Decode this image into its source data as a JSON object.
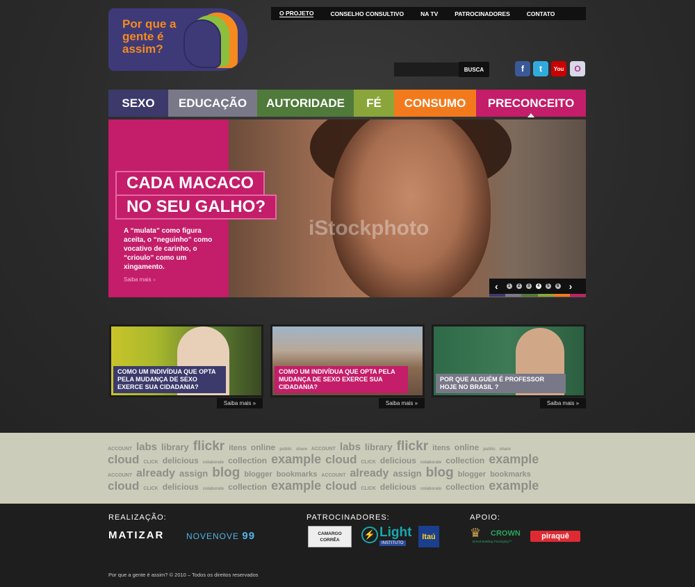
{
  "logo": {
    "text": "Por que a gente é assim?"
  },
  "top_nav": [
    "O PROJETO",
    "CONSELHO CONSULTIVO",
    "NA TV",
    "PATROCINADORES",
    "CONTATO"
  ],
  "search": {
    "button": "BUSCA"
  },
  "social": [
    {
      "icon": "facebook-icon",
      "glyph": "f",
      "color": "#3b5998"
    },
    {
      "icon": "twitter-icon",
      "glyph": "t",
      "color": "#33aadd"
    },
    {
      "icon": "youtube-icon",
      "glyph": "You",
      "color": "#cc0000"
    },
    {
      "icon": "orkut-icon",
      "glyph": "O",
      "color": "#d8d8e8"
    }
  ],
  "categories": [
    {
      "label": "SEXO",
      "color": "#3b3a6b"
    },
    {
      "label": "EDUCAÇÃO",
      "color": "#787888"
    },
    {
      "label": "AUTORIDADE",
      "color": "#4f7a3a"
    },
    {
      "label": "FÉ",
      "color": "#8aa53a"
    },
    {
      "label": "CONSUMO",
      "color": "#f27a1c"
    },
    {
      "label": "PRECONCEITO",
      "color": "#c41d69"
    }
  ],
  "hero": {
    "headline_1": "CADA MACACO",
    "headline_2": "NO SEU GALHO?",
    "description": "A “mulata” como figura aceita, o “neguinho” como vocativo de carinho, o “crioulo” como um xingamento.",
    "more": "Saiba mais",
    "watermark": "iStockphoto",
    "pager": [
      "1",
      "2",
      "3",
      "4",
      "5",
      "6"
    ],
    "active_page": 4
  },
  "cards": [
    {
      "caption": "COMO UM INDIVÍDUA QUE OPTA PELA MUDANÇA DE SEXO EXERCE SUA CIDADANIA?",
      "cap_color": "#3b3a6b",
      "more": "Saiba mais"
    },
    {
      "caption": "COMO UM INDIVÍDUA QUE OPTA PELA MUDANÇA DE SEXO EXERCE SUA CIDADANIA?",
      "cap_color": "#c41d69",
      "more": "Saiba mais"
    },
    {
      "caption": "POR QUE ALGUÉM É PROFESSOR HOJE NO BRASIL ?",
      "cap_color": "#787888",
      "more": "Saiba mais"
    }
  ],
  "tag_cloud": [
    [
      "ACCOUNT",
      "labs",
      "library",
      "flickr",
      "itens",
      "online",
      "public",
      "share",
      "ACCOUNT",
      "labs",
      "library",
      "flickr",
      "itens",
      "online",
      "public",
      "share"
    ],
    [
      "cloud",
      "CLICK",
      "delicious",
      "colaborate",
      "collection",
      "example",
      "cloud",
      "CLICK",
      "delicious",
      "colaborate",
      "collection",
      "example"
    ],
    [
      "ACCOUNT",
      "already",
      "assign",
      "blog",
      "blogger",
      "bookmarks",
      "ACCOUNT",
      "already",
      "assign",
      "blog",
      "blogger",
      "bookmarks"
    ],
    [
      "cloud",
      "CLICK",
      "delicious",
      "colaborate",
      "collection",
      "example",
      "cloud",
      "CLICK",
      "delicious",
      "colaborate",
      "collection",
      "example"
    ]
  ],
  "footer": {
    "realizacao": "REALIZAÇÃO:",
    "patrocinadores": "PATROCINADORES:",
    "apoio": "APOIO:",
    "brands": {
      "matizar": "MATIZAR",
      "novenove": "NOVENOVE",
      "camargo_1": "CAMARGO",
      "camargo_2": "CORRÊA",
      "light": "Light",
      "light_sub": "INSTITUTO",
      "itau": "Itaú",
      "crown": "CROWN",
      "crown_sub": "Brand-Building Packaging™",
      "piraque": "piraquê"
    },
    "copyright": "Por que a gente é assim? © 2010 – Todos os direitos reservados"
  }
}
